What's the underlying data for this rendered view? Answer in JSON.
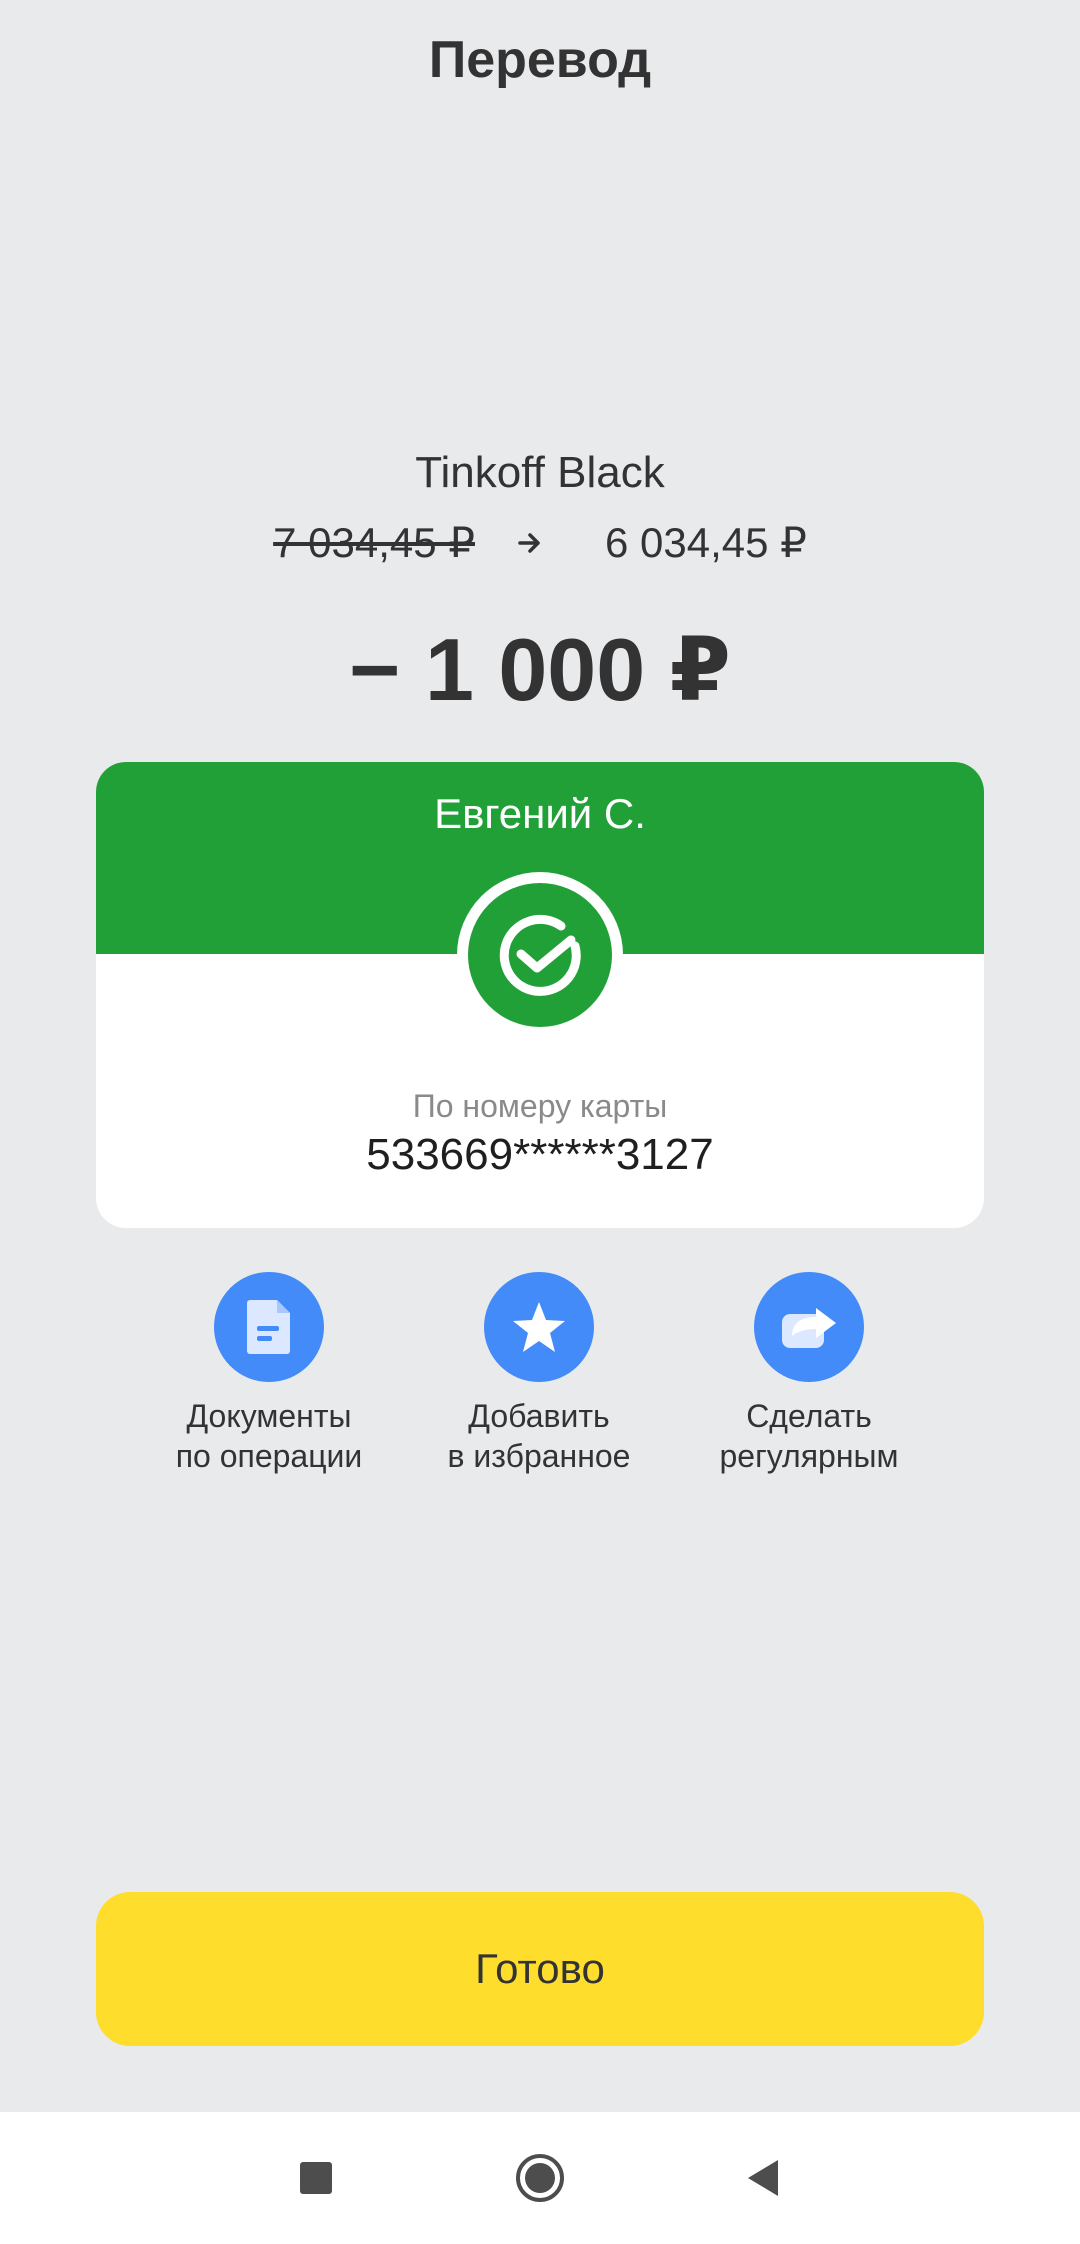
{
  "header": {
    "title": "Перевод"
  },
  "account": {
    "name": "Tinkoff Black",
    "balance_before": "7 034,45 ₽",
    "balance_after": "6 034,45 ₽"
  },
  "amount": "− 1 000 ₽",
  "recipient": {
    "name": "Евгений С.",
    "bank_logo_icon": "sberbank-logo-icon",
    "method": "По номеру карты",
    "card_number": "533669******3127"
  },
  "actions": [
    {
      "icon": "document-icon",
      "line1": "Документы",
      "line2": "по операции"
    },
    {
      "icon": "star-icon",
      "line1": "Добавить",
      "line2": "в избранное"
    },
    {
      "icon": "repeat-arrow-icon",
      "line1": "Сделать",
      "line2": "регулярным"
    }
  ],
  "done_button": "Готово",
  "colors": {
    "background": "#e9eaec",
    "success_green": "#21a038",
    "action_blue": "#428bf9",
    "button_yellow": "#ffdd2d"
  },
  "navbar": {
    "icons": [
      "recents-square-icon",
      "home-circle-icon",
      "back-triangle-icon"
    ]
  }
}
